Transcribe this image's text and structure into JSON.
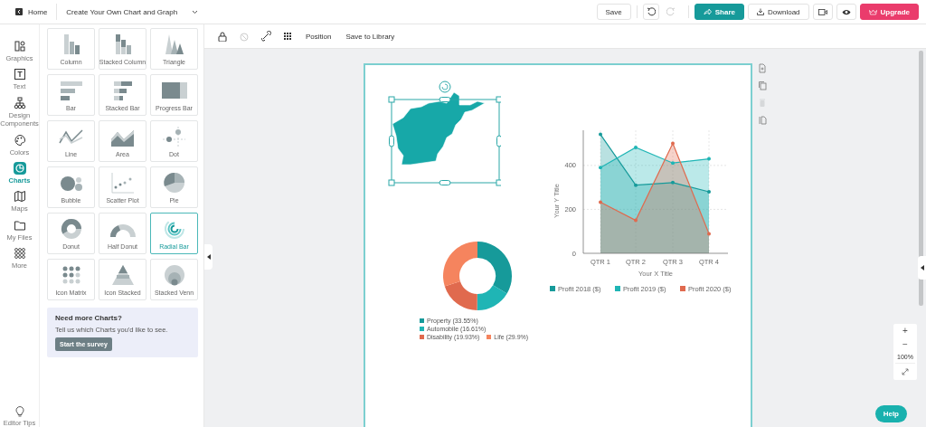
{
  "top_bar": {
    "home": "Home",
    "title": "Create Your Own Chart and Graph",
    "save": "Save",
    "history": [
      {
        "disabled": false
      },
      {
        "disabled": true
      }
    ],
    "share": "Share",
    "download": "Download",
    "upgrade": "Upgrade"
  },
  "rail": {
    "items": [
      {
        "label": "Graphics",
        "selected": false
      },
      {
        "label": "Text",
        "selected": false
      },
      {
        "label": "Design Components",
        "selected": false
      },
      {
        "label": "Colors",
        "selected": false
      },
      {
        "label": "Charts",
        "selected": true
      },
      {
        "label": "Maps",
        "selected": false
      },
      {
        "label": "My Files",
        "selected": false
      },
      {
        "label": "More",
        "selected": false
      }
    ],
    "tips": "Editor Tips"
  },
  "chart_types": [
    {
      "label": "Column",
      "selected": false
    },
    {
      "label": "Stacked Column",
      "selected": false
    },
    {
      "label": "Triangle",
      "selected": false
    },
    {
      "label": "Bar",
      "selected": false
    },
    {
      "label": "Stacked Bar",
      "selected": false
    },
    {
      "label": "Progress Bar",
      "selected": false
    },
    {
      "label": "Line",
      "selected": false
    },
    {
      "label": "Area",
      "selected": false
    },
    {
      "label": "Dot",
      "selected": false
    },
    {
      "label": "Bubble",
      "selected": false
    },
    {
      "label": "Scatter Plot",
      "selected": false
    },
    {
      "label": "Pie",
      "selected": false
    },
    {
      "label": "Donut",
      "selected": false
    },
    {
      "label": "Half Donut",
      "selected": false
    },
    {
      "label": "Radial Bar",
      "selected": true
    },
    {
      "label": "Icon Matrix",
      "selected": false
    },
    {
      "label": "Icon Stacked",
      "selected": false
    },
    {
      "label": "Stacked Venn",
      "selected": false
    }
  ],
  "survey": {
    "title": "Need more Charts?",
    "text": "Tell us which Charts you'd like to see.",
    "button": "Start the survey"
  },
  "toolbar": {
    "tools": [
      {
        "disabled": false
      },
      {
        "disabled": true
      },
      {
        "disabled": false
      },
      {
        "disabled": false
      }
    ],
    "actions": [
      "Position",
      "Save to Library"
    ]
  },
  "page_tools": [
    {
      "disabled": false
    },
    {
      "disabled": false
    },
    {
      "disabled": true
    },
    {
      "disabled": false
    }
  ],
  "line_chart": {
    "chart_data": {
      "type": "area",
      "grid": true,
      "legend": "bottom",
      "xlabel": "Your X Title",
      "ylabel": "Your Y Title",
      "categories": [
        "QTR 1",
        "QTR 2",
        "QTR 3",
        "QTR 4"
      ],
      "ylim": [
        0,
        560
      ],
      "yticks": [
        0,
        200,
        400
      ],
      "series": [
        {
          "name": "Profit 2018 ($)",
          "color": "#169a9a",
          "values": [
            541,
            310,
            322,
            280
          ]
        },
        {
          "name": "Profit 2019 ($)",
          "color": "#1fb5b5",
          "values": [
            390,
            482,
            411,
            430
          ]
        },
        {
          "name": "Profit 2020 ($)",
          "color": "#e06a4e",
          "values": [
            233,
            150,
            500,
            89
          ]
        }
      ]
    }
  },
  "donut_chart": {
    "chart_data": {
      "type": "donut",
      "values": [
        33.55,
        16.61,
        19.93,
        29.9
      ]
    },
    "legend": [
      {
        "label": "Property (33.55%)",
        "color": "#169a9a"
      },
      {
        "label": "Automobile (16.61%)",
        "color": "#1fb5b5"
      },
      {
        "label": "Disability (19.93%)",
        "color": "#e06a4e"
      },
      {
        "label": "Life (29.9%)",
        "color": "#f5845e"
      }
    ]
  },
  "zoom": {
    "level_text": "100%",
    "plus": "+",
    "minus": "−"
  },
  "help": "Help"
}
